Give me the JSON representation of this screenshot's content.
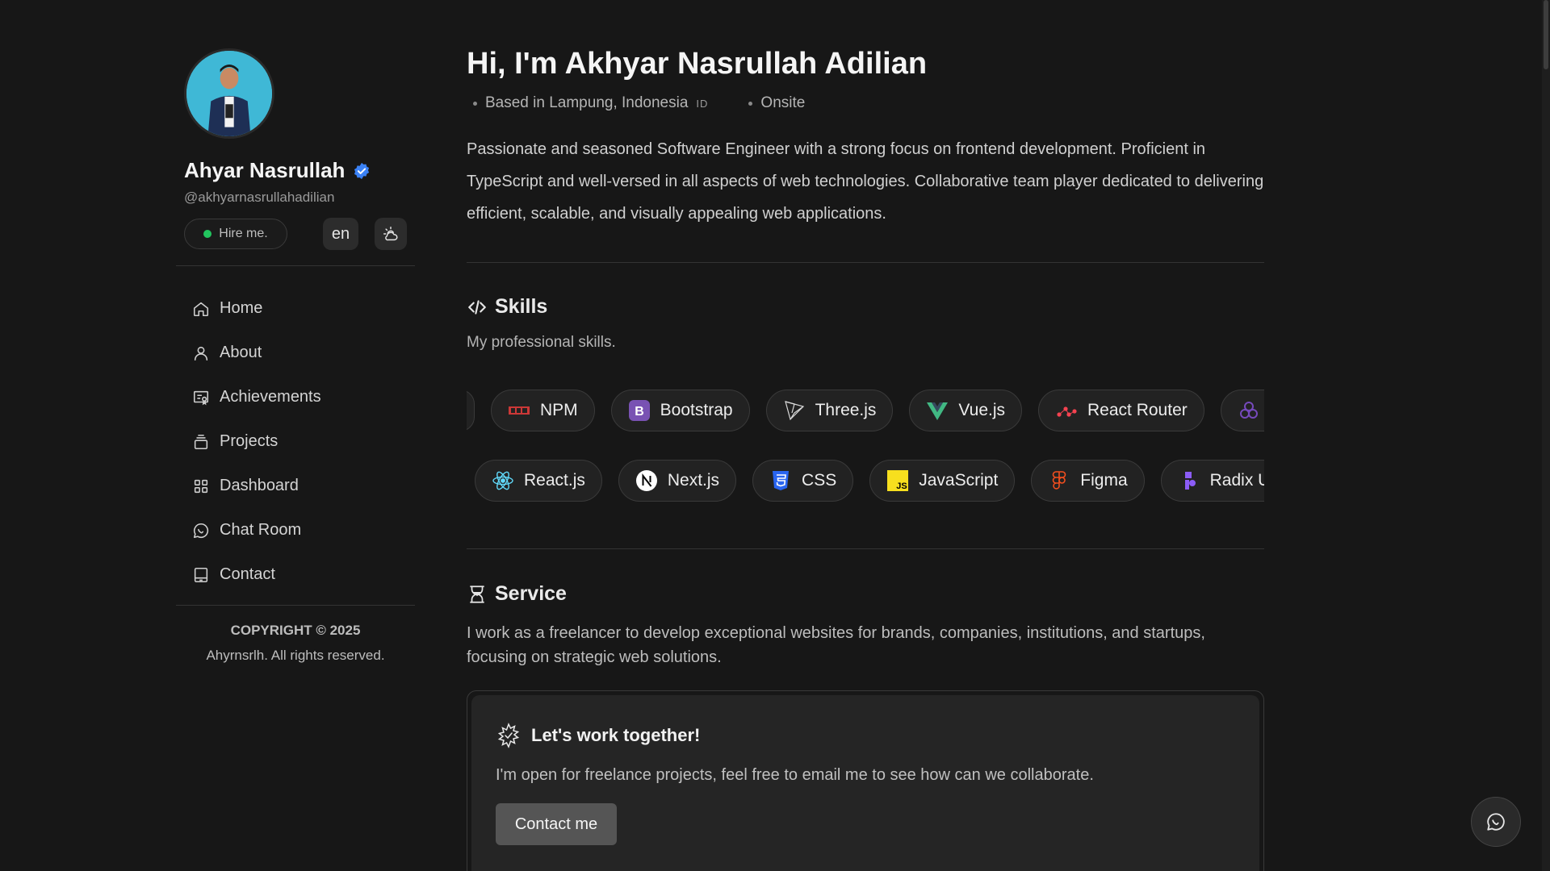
{
  "sidebar": {
    "profile_name": "Ahyar Nasrullah",
    "handle": "@akhyarnasrullahadilian",
    "hire_label": "Hire me.",
    "lang_label": "en",
    "nav": [
      {
        "label": "Home",
        "icon": "home-icon"
      },
      {
        "label": "About",
        "icon": "user-icon"
      },
      {
        "label": "Achievements",
        "icon": "achievement-icon"
      },
      {
        "label": "Projects",
        "icon": "projects-icon"
      },
      {
        "label": "Dashboard",
        "icon": "dashboard-icon"
      },
      {
        "label": "Chat Room",
        "icon": "chat-icon"
      },
      {
        "label": "Contact",
        "icon": "contact-icon"
      }
    ],
    "copyright": "COPYRIGHT © 2025",
    "rights": "Ahyrnsrlh. All rights reserved."
  },
  "hero": {
    "title": "Hi, I'm Akhyar Nasrullah Adilian",
    "location": "Based in Lampung, Indonesia",
    "flag": "ID",
    "work_mode": "Onsite",
    "bio": "Passionate and seasoned Software Engineer with a strong focus on frontend development. Proficient in TypeScript and well-versed in all aspects of web technologies. Collaborative team player dedicated to delivering efficient, scalable, and visually appealing web applications."
  },
  "skills": {
    "title": "Skills",
    "subtitle": "My professional skills.",
    "row1": [
      "NPM",
      "Bootstrap",
      "Three.js",
      "Vue.js",
      "React Router"
    ],
    "row2": [
      "React.js",
      "Next.js",
      "CSS",
      "JavaScript",
      "Figma",
      "Radix UI"
    ]
  },
  "service": {
    "title": "Service",
    "description": "I work as a freelancer to develop exceptional websites for brands, companies, institutions, and startups, focusing on strategic web solutions.",
    "cta_title": "Let's work together!",
    "cta_text": "I'm open for freelance projects, feel free to email me to see how can we collaborate.",
    "cta_button": "Contact me"
  },
  "colors": {
    "background": "#171717",
    "online": "#22c55e",
    "verified": "#3b82f6"
  }
}
